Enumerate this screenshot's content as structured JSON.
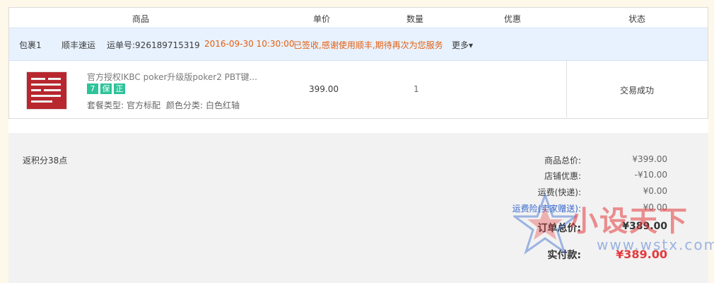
{
  "header": {
    "product": "商品",
    "unit_price": "单价",
    "quantity": "数量",
    "discount": "优惠",
    "status": "状态"
  },
  "package": {
    "name": "包裹1",
    "carrier": "顺丰速运",
    "tracking": "运单号:926189715319",
    "time": "2016-09-30 10:30:00",
    "message": "已签收,感谢使用顺丰,期待再次为您服务",
    "more": "更多"
  },
  "item": {
    "title": "官方授权IKBC poker升级版poker2 PBT键...",
    "badges": [
      "7",
      "保",
      "正"
    ],
    "attr_package_label": "套餐类型:",
    "attr_package_value": "官方标配",
    "attr_color_label": "颜色分类:",
    "attr_color_value": "白色红轴",
    "price": "399.00",
    "qty": "1",
    "status": "交易成功"
  },
  "summary": {
    "points": "返积分38点",
    "goods_total_label": "商品总价:",
    "goods_total": "¥399.00",
    "shop_discount_label": "店铺优惠:",
    "shop_discount": "-¥10.00",
    "shipping_label": "运费(快递):",
    "shipping": "¥0.00",
    "insurance_label": "运费险(卖家赠送):",
    "insurance": "¥0.00",
    "order_total_label": "订单总价:",
    "order_total": "¥389.00",
    "paid_label": "实付款:",
    "paid": "¥389.00"
  },
  "watermark": {
    "text": "小设天下",
    "url": "www.wstx.com"
  },
  "colors": {
    "accent_orange": "#e25f11",
    "badge_green": "#2ec39a",
    "paid_red": "#e4393c",
    "package_bar": "#e8f2ff"
  }
}
